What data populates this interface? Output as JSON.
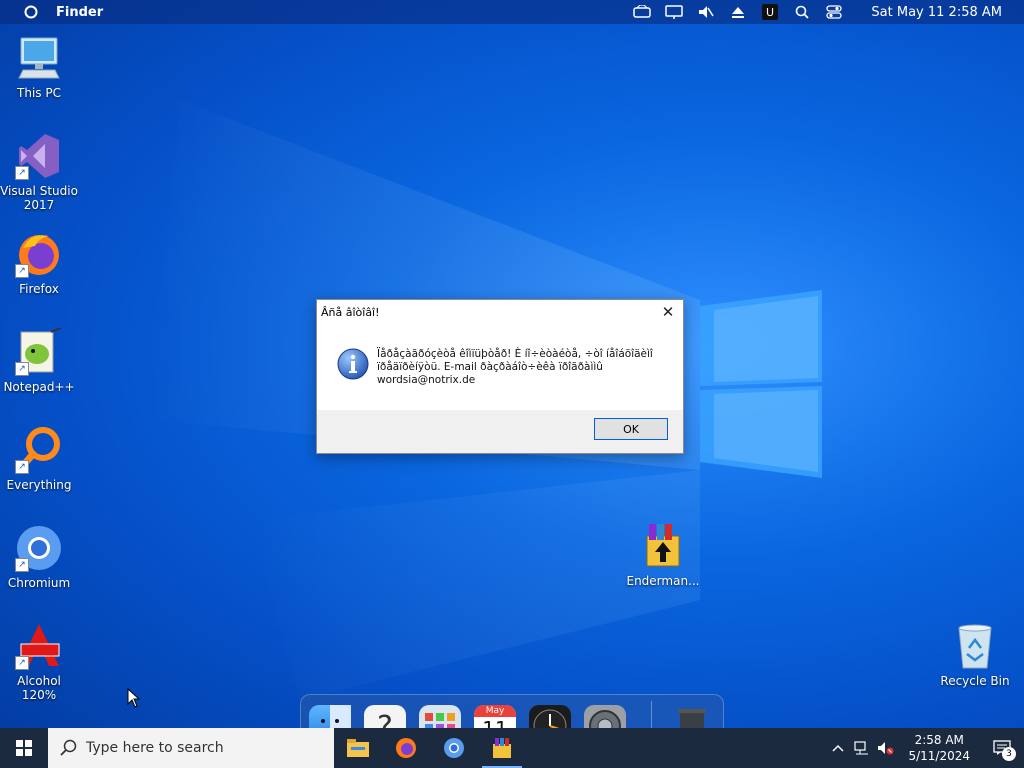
{
  "menubar": {
    "app_name": "Finder",
    "datetime": "Sat May 11  2:58 AM",
    "icons": [
      "circle-icon",
      "cast-icon",
      "monitor-icon",
      "mute-icon",
      "eject-icon",
      "u-icon",
      "search-icon",
      "control-center-icon"
    ]
  },
  "desktop_icons": [
    {
      "id": "this-pc",
      "label": "This PC"
    },
    {
      "id": "visual-studio",
      "label": "Visual Studio 2017"
    },
    {
      "id": "firefox",
      "label": "Firefox"
    },
    {
      "id": "notepadpp",
      "label": "Notepad++"
    },
    {
      "id": "everything",
      "label": "Everything"
    },
    {
      "id": "chromium",
      "label": "Chromium"
    },
    {
      "id": "alcohol",
      "label": "Alcohol 120%"
    },
    {
      "id": "enderman",
      "label": "Enderman..."
    },
    {
      "id": "recycle-bin",
      "label": "Recycle Bin"
    }
  ],
  "dialog": {
    "title": "Âñå âîòîâî!",
    "message_line1": "Ïåðåçàãðóçèòå êîìïüþòåð! È íî÷èòàéòå, ÷òî íåîáõîäèìî",
    "message_line2": "ïðåäïðèíÿòü. E-mail ðàçðàáîò÷èêà ïðîãðàììû",
    "message_line3": "wordsia@notrix.de",
    "ok_label": "OK",
    "close_glyph": "✕"
  },
  "dock": {
    "calendar_month": "May",
    "calendar_day": "11"
  },
  "taskbar": {
    "search_placeholder": "Type here to search",
    "time": "2:58 AM",
    "date": "5/11/2024",
    "notification_count": "3"
  },
  "colors": {
    "taskbar": "#1c2a40",
    "accent": "#0f5ec8",
    "desktop": "#0a67e0"
  }
}
